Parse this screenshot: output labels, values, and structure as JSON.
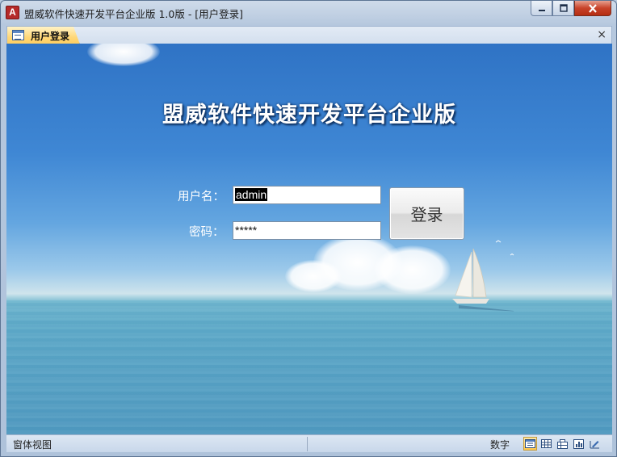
{
  "window": {
    "app_icon_letter": "A",
    "title": "盟威软件快速开发平台企业版 1.0版 - [用户登录]"
  },
  "document_tab": {
    "label": "用户登录",
    "close_glyph": "×"
  },
  "form": {
    "heading": "盟威软件快速开发平台企业版",
    "username_label": "用户名：",
    "username_value": "admin",
    "password_label": "密码：",
    "password_value": "*****",
    "login_button_label": "登录"
  },
  "status_bar": {
    "left_text": "窗体视图",
    "right_text": "数字",
    "view_buttons": [
      "form-view-icon",
      "datasheet-view-icon",
      "pivot-table-icon",
      "pivot-chart-icon",
      "design-view-icon"
    ]
  },
  "colors": {
    "tab_active": "#ffd778",
    "title_shadow": "#0d2f5e",
    "close_button": "#c8432a"
  }
}
